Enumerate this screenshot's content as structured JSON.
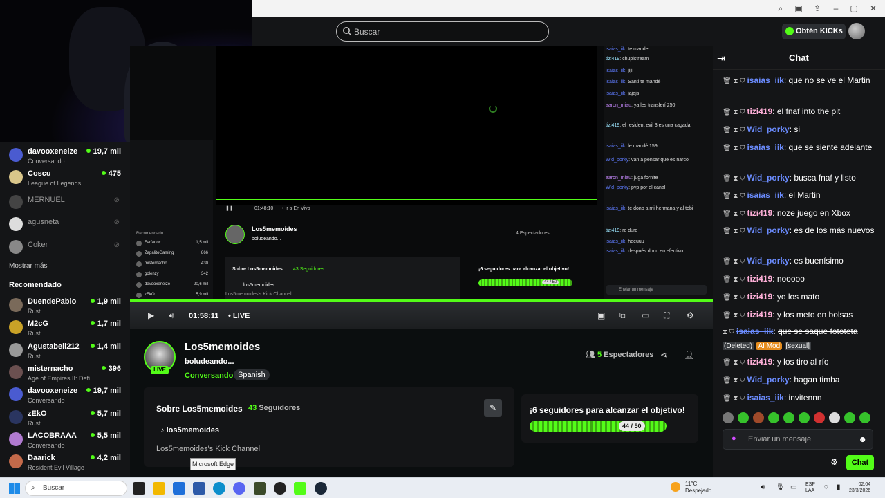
{
  "nav": {
    "search_placeholder": "Buscar",
    "kicks_label": "Obtén KICKs"
  },
  "sidebar": {
    "items": [
      {
        "name": "davooxeneize",
        "category": "Conversando",
        "viewers": "19,7 mil",
        "live": true
      },
      {
        "name": "Coscu",
        "category": "League of Legends",
        "viewers": "475",
        "live": true
      },
      {
        "name": "MERNUEL",
        "category": "",
        "viewers": "",
        "live": false
      },
      {
        "name": "agusneta",
        "category": "",
        "viewers": "",
        "live": false
      },
      {
        "name": "Coker",
        "category": "",
        "viewers": "",
        "live": false
      }
    ],
    "show_more": "Mostrar más",
    "recommended_header": "Recomendado",
    "recommended": [
      {
        "name": "DuendePablo",
        "category": "Rust",
        "viewers": "1,9 mil"
      },
      {
        "name": "M2cG",
        "category": "Rust",
        "viewers": "1,7 mil"
      },
      {
        "name": "Agustabell212",
        "category": "Rust",
        "viewers": "1,4 mil"
      },
      {
        "name": "misternacho",
        "category": "Age of Empires II: Defi...",
        "viewers": "396"
      },
      {
        "name": "davooxeneize",
        "category": "Conversando",
        "viewers": "19,7 mil"
      },
      {
        "name": "zEkO",
        "category": "Rust",
        "viewers": "5,7 mil"
      },
      {
        "name": "LACOBRAAA",
        "category": "Conversando",
        "viewers": "5,5 mil"
      },
      {
        "name": "Daarick",
        "category": "Resident Evil Village",
        "viewers": "4,2 mil"
      }
    ]
  },
  "nested": {
    "time": "01:48:10",
    "live_label": "Ir a En Vivo",
    "channel": "Los5memoides",
    "title": "boludeando...",
    "viewers": "4 Espectadores",
    "about": "Sobre Los5memoides",
    "followers": "43 Seguidores",
    "tiktok": "los5memoides",
    "desc": "Los5memoides's Kick Channel",
    "goal": "¡6 seguidores para alcanzar el objetivo!",
    "goal_count": "44 / 50",
    "input_placeholder": "Enviar un mensaje",
    "side_items": [
      {
        "name": "Farfadox",
        "viewers": "1,5 mil"
      },
      {
        "name": "ZapalitoGaming",
        "viewers": "866"
      },
      {
        "name": "misternacho",
        "viewers": "430"
      },
      {
        "name": "golenzy",
        "viewers": "342"
      },
      {
        "name": "davooxeneize",
        "viewers": "20,6 mil"
      },
      {
        "name": "zEkO",
        "viewers": "5,9 mil"
      },
      {
        "name": "LACOBRAAA",
        "viewers": "5,7 mil"
      }
    ],
    "chat": [
      {
        "user": "isaias_iik",
        "text": "te mande",
        "c": "u"
      },
      {
        "user": "tizi419",
        "text": "chupistream",
        "c": "u g"
      },
      {
        "user": "isaias_iik",
        "text": "jiji",
        "c": "u"
      },
      {
        "user": "isaias_iik",
        "text": "Santi te mandé",
        "c": "u"
      },
      {
        "user": "isaias_iik",
        "text": "jajajs",
        "c": "u"
      },
      {
        "user": "aaron_miau",
        "text": "ya les transferí 250",
        "c": "u p"
      },
      {
        "user": "tizi419",
        "text": "el resident evil 3 es una cagada",
        "c": "u g"
      },
      {
        "user": "isaias_iik",
        "text": "le mandé 159",
        "c": "u"
      },
      {
        "user": "Wid_porky",
        "text": "van a pensar que es narco",
        "c": "u"
      },
      {
        "user": "aaron_miau",
        "text": "juga fornite",
        "c": "u p"
      },
      {
        "user": "Wid_porky",
        "text": "pvp por el canal",
        "c": "u"
      },
      {
        "user": "isaias_iik",
        "text": "te dono a mi hermana y al tobi",
        "c": "u"
      },
      {
        "user": "tizi419",
        "text": "re duro",
        "c": "u g"
      },
      {
        "user": "isaias_iik",
        "text": "heeuuu",
        "c": "u"
      },
      {
        "user": "isaias_iik",
        "text": "después dono en efectivo",
        "c": "u"
      }
    ]
  },
  "player": {
    "time": "01:58:11",
    "live": "LIVE"
  },
  "channel": {
    "name": "Los5memoides",
    "title": "boludeando...",
    "category": "Conversando",
    "language": "Spanish",
    "live_badge": "LIVE",
    "viewers_count": "5",
    "viewers_label": "Espectadores",
    "about_title": "Sobre Los5memoides",
    "followers_count": "43",
    "followers_label": "Seguidores",
    "tiktok": "los5memoides",
    "description": "Los5memoides's Kick Channel",
    "goal_title": "¡6 seguidores para alcanzar el objetivo!",
    "goal_count": "44 / 50",
    "goal_fraction": 0.88
  },
  "chat": {
    "title": "Chat",
    "messages": [
      {
        "user": "isaias_iik",
        "text": "que no se ve el Martin",
        "color": "u-blue"
      },
      {
        "user": "tizi419",
        "text": "el fnaf into the pit",
        "color": "u-pink"
      },
      {
        "user": "Wid_porky",
        "text": "si",
        "color": "u-blue"
      },
      {
        "user": "isaias_iik",
        "text": "que se siente adelante",
        "color": "u-blue"
      },
      {
        "user": "Wid_porky",
        "text": "busca fnaf y listo",
        "color": "u-blue"
      },
      {
        "user": "isaias_iik",
        "text": "el Martin",
        "color": "u-blue"
      },
      {
        "user": "tizi419",
        "text": "noze juego en Xbox",
        "color": "u-pink"
      },
      {
        "user": "Wid_porky",
        "text": "es de los más nuevos",
        "color": "u-blue"
      },
      {
        "user": "Wid_porky",
        "text": "es buenísimo",
        "color": "u-blue"
      },
      {
        "user": "tizi419",
        "text": "nooooo",
        "color": "u-pink"
      },
      {
        "user": "tizi419",
        "text": "yo los mato",
        "color": "u-pink"
      },
      {
        "user": "tizi419",
        "text": "y los meto en bolsas",
        "color": "u-pink"
      }
    ],
    "deleted": {
      "user": "isaias_iik",
      "text": "que se saque fototeta",
      "deleted_label": "(Deleted)",
      "mod_label": "AI Mod",
      "reason": "[sexual]"
    },
    "after": [
      {
        "user": "tizi419",
        "text": "y los tiro al río",
        "color": "u-pink"
      },
      {
        "user": "Wid_porky",
        "text": "hagan timba",
        "color": "u-blue"
      },
      {
        "user": "isaias_iik",
        "text": "invitennn",
        "color": "u-blue"
      }
    ],
    "input_placeholder": "Enviar un mensaje",
    "send_label": "Chat"
  },
  "tooltip": "Microsoft Edge",
  "taskbar": {
    "search_placeholder": "Buscar",
    "temp": "11°C",
    "weather": "Despejado",
    "lang1": "ESP",
    "lang2": "LAA",
    "time": "02:04",
    "date": "23/3/2026"
  },
  "colors": {
    "accent": "#53fc18",
    "bg": "#0b0e0f",
    "panel": "#141517"
  }
}
